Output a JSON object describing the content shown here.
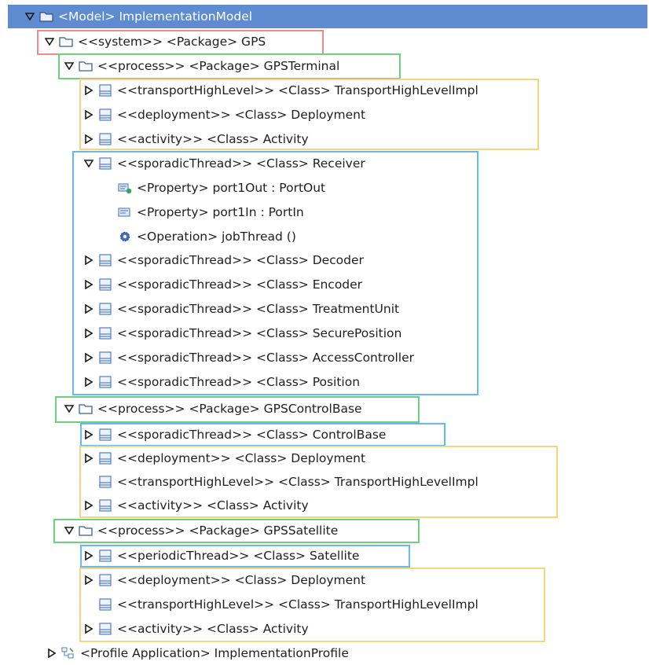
{
  "header": {
    "label": "<Model> ImplementationModel"
  },
  "colors": {
    "header_bg": "#5f8bd0",
    "system_box": "#ef8a8a",
    "process_box": "#6fcf7f",
    "thread_box": "#69b7f0",
    "support_box": "#f3d77e",
    "icon_blue": "#5d86c6"
  },
  "tree": [
    {
      "label": "<<system>> <Package> GPS",
      "icon": "folder-icon",
      "expand": "open",
      "name": "package-gps"
    },
    {
      "label": "<<process>> <Package> GPSTerminal",
      "icon": "folder-icon",
      "expand": "open",
      "name": "package-gpsterminal"
    },
    {
      "label": "<<transportHighLevel>> <Class> TransportHighLevelImpl",
      "icon": "class-icon",
      "expand": "closed",
      "name": "class-transport-terminal"
    },
    {
      "label": "<<deployment>> <Class> Deployment",
      "icon": "class-icon",
      "expand": "closed",
      "name": "class-deployment-terminal"
    },
    {
      "label": "<<activity>> <Class> Activity",
      "icon": "class-icon",
      "expand": "closed",
      "name": "class-activity-terminal"
    },
    {
      "label": "<<sporadicThread>> <Class> Receiver",
      "icon": "class-icon",
      "expand": "open",
      "name": "class-receiver"
    },
    {
      "label": "<Property> port1Out : PortOut",
      "icon": "property-out-icon",
      "expand": "none",
      "name": "property-port1out"
    },
    {
      "label": "<Property> port1In : PortIn",
      "icon": "property-in-icon",
      "expand": "none",
      "name": "property-port1in"
    },
    {
      "label": "<Operation> jobThread ()",
      "icon": "operation-gear-icon",
      "expand": "none",
      "name": "operation-jobthread"
    },
    {
      "label": "<<sporadicThread>> <Class> Decoder",
      "icon": "class-icon",
      "expand": "closed",
      "name": "class-decoder"
    },
    {
      "label": "<<sporadicThread>> <Class> Encoder",
      "icon": "class-icon",
      "expand": "closed",
      "name": "class-encoder"
    },
    {
      "label": "<<sporadicThread>> <Class> TreatmentUnit",
      "icon": "class-icon",
      "expand": "closed",
      "name": "class-treatmentunit"
    },
    {
      "label": "<<sporadicThread>> <Class> SecurePosition",
      "icon": "class-icon",
      "expand": "closed",
      "name": "class-secureposition"
    },
    {
      "label": "<<sporadicThread>> <Class> AccessController",
      "icon": "class-icon",
      "expand": "closed",
      "name": "class-accesscontroller"
    },
    {
      "label": "<<sporadicThread>> <Class> Position",
      "icon": "class-icon",
      "expand": "closed",
      "name": "class-position"
    },
    {
      "label": "<<process>> <Package> GPSControlBase",
      "icon": "folder-icon",
      "expand": "open",
      "name": "package-gpscontrolbase"
    },
    {
      "label": "<<sporadicThread>> <Class> ControlBase",
      "icon": "class-icon",
      "expand": "closed",
      "name": "class-controlbase"
    },
    {
      "label": "<<deployment>> <Class> Deployment",
      "icon": "class-icon",
      "expand": "closed",
      "name": "class-deployment-controlbase"
    },
    {
      "label": "<<transportHighLevel>> <Class> TransportHighLevelImpl",
      "icon": "class-icon",
      "expand": "none",
      "name": "class-transport-controlbase"
    },
    {
      "label": "<<activity>> <Class> Activity",
      "icon": "class-icon",
      "expand": "closed",
      "name": "class-activity-controlbase"
    },
    {
      "label": "<<process>> <Package> GPSSatellite",
      "icon": "folder-icon",
      "expand": "open",
      "name": "package-gpssatellite"
    },
    {
      "label": "<<periodicThread>> <Class> Satellite",
      "icon": "class-icon",
      "expand": "closed",
      "name": "class-satellite"
    },
    {
      "label": "<<deployment>> <Class> Deployment",
      "icon": "class-icon",
      "expand": "closed",
      "name": "class-deployment-satellite"
    },
    {
      "label": "<<transportHighLevel>> <Class> TransportHighLevelImpl",
      "icon": "class-icon",
      "expand": "none",
      "name": "class-transport-satellite"
    },
    {
      "label": "<<activity>> <Class> Activity",
      "icon": "class-icon",
      "expand": "closed",
      "name": "class-activity-satellite"
    },
    {
      "label": "<Profile Application> ImplementationProfile",
      "icon": "profile-application-icon",
      "expand": "closed",
      "name": "profile-application"
    }
  ]
}
